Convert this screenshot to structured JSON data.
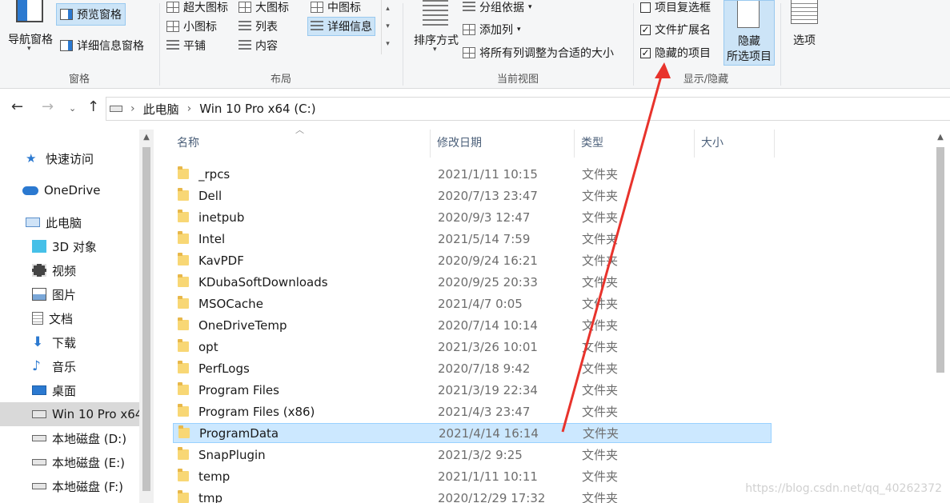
{
  "ribbon": {
    "pane_group": {
      "label": "窗格",
      "nav_pane": "导航窗格",
      "preview_pane": "预览窗格",
      "details_pane": "详细信息窗格"
    },
    "layout_group": {
      "label": "布局",
      "extra_large_icons": "超大图标",
      "large_icons": "大图标",
      "medium_icons": "中图标",
      "small_icons": "小图标",
      "list": "列表",
      "details": "详细信息",
      "tiles": "平铺",
      "content": "内容"
    },
    "current_view_group": {
      "label": "当前视图",
      "sort_by": "排序方式",
      "group_by": "分组依据",
      "add_columns": "添加列",
      "size_all_columns": "将所有列调整为合适的大小"
    },
    "show_hide_group": {
      "label": "显示/隐藏",
      "item_checkboxes": "项目复选框",
      "file_extensions": "文件扩展名",
      "hidden_items": "隐藏的项目",
      "hide_selected_line1": "隐藏",
      "hide_selected_line2": "所选项目"
    },
    "options_label": "选项"
  },
  "address": {
    "part1": "此电脑",
    "part2": "Win 10 Pro x64 (C:)"
  },
  "nav": {
    "items": [
      {
        "label": "快速访问"
      },
      {
        "label": "OneDrive"
      },
      {
        "label": "此电脑"
      },
      {
        "label": "3D 对象"
      },
      {
        "label": "视频"
      },
      {
        "label": "图片"
      },
      {
        "label": "文档"
      },
      {
        "label": "下载"
      },
      {
        "label": "音乐"
      },
      {
        "label": "桌面"
      },
      {
        "label": "Win 10 Pro x64"
      },
      {
        "label": "本地磁盘 (D:)"
      },
      {
        "label": "本地磁盘 (E:)"
      },
      {
        "label": "本地磁盘 (F:)"
      }
    ]
  },
  "list": {
    "headers": {
      "name": "名称",
      "date": "修改日期",
      "type": "类型",
      "size": "大小"
    },
    "rows": [
      {
        "name": "_rpcs",
        "date": "2021/1/11 10:15",
        "type": "文件夹"
      },
      {
        "name": "Dell",
        "date": "2020/7/13 23:47",
        "type": "文件夹"
      },
      {
        "name": "inetpub",
        "date": "2020/9/3 12:47",
        "type": "文件夹"
      },
      {
        "name": "Intel",
        "date": "2021/5/14 7:59",
        "type": "文件夹"
      },
      {
        "name": "KavPDF",
        "date": "2020/9/24 16:21",
        "type": "文件夹"
      },
      {
        "name": "KDubaSoftDownloads",
        "date": "2020/9/25 20:33",
        "type": "文件夹"
      },
      {
        "name": "MSOCache",
        "date": "2021/4/7 0:05",
        "type": "文件夹"
      },
      {
        "name": "OneDriveTemp",
        "date": "2020/7/14 10:14",
        "type": "文件夹"
      },
      {
        "name": "opt",
        "date": "2021/3/26 10:01",
        "type": "文件夹"
      },
      {
        "name": "PerfLogs",
        "date": "2020/7/18 9:42",
        "type": "文件夹"
      },
      {
        "name": "Program Files",
        "date": "2021/3/19 22:34",
        "type": "文件夹"
      },
      {
        "name": "Program Files (x86)",
        "date": "2021/4/3 23:47",
        "type": "文件夹"
      },
      {
        "name": "ProgramData",
        "date": "2021/4/14 16:14",
        "type": "文件夹"
      },
      {
        "name": "SnapPlugin",
        "date": "2021/3/2 9:25",
        "type": "文件夹"
      },
      {
        "name": "temp",
        "date": "2021/1/11 10:11",
        "type": "文件夹"
      },
      {
        "name": "tmp",
        "date": "2020/12/29 17:32",
        "type": "文件夹"
      }
    ]
  },
  "watermark": "https://blog.csdn.net/qq_40262372",
  "colors": {
    "selection": "#cce8ff",
    "annotation_arrow": "#e8332c"
  }
}
